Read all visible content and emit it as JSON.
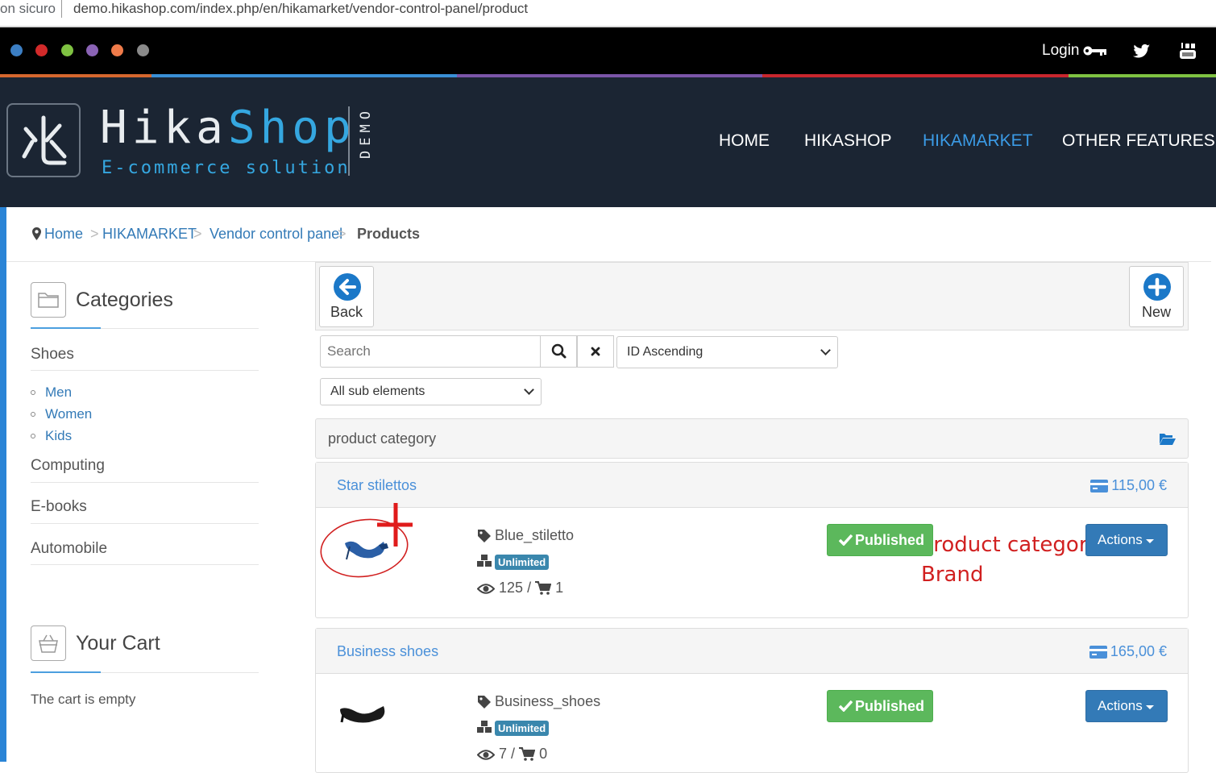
{
  "browser": {
    "insecure_label": "on sicuro",
    "url": "demo.hikashop.com/index.php/en/hikamarket/vendor-control-panel/product"
  },
  "topbar": {
    "dots": [
      "#3c7fc4",
      "#d22a2a",
      "#7fc242",
      "#8a63b5",
      "#ef7b4a",
      "#8a8a8a"
    ],
    "login_label": "Login",
    "icons": [
      "key-icon",
      "twitter-icon",
      "youtube-icon"
    ]
  },
  "colors": {
    "lines": [
      "#d5672e",
      "#3a8fd6",
      "#7b55a8",
      "#c8262d",
      "#7fc242"
    ],
    "accent": "#35a7e0",
    "header_bg": "#1b2533"
  },
  "logo": {
    "title_a": "Hika",
    "title_b": "Shop",
    "subtitle": "E-commerce solution",
    "demo": "DEMO"
  },
  "nav": {
    "items": [
      "HOME",
      "HIKASHOP",
      "HIKAMARKET",
      "OTHER FEATURES"
    ],
    "active": "HIKAMARKET"
  },
  "breadcrumb": {
    "home": "Home",
    "hikamarket": "HIKAMARKET",
    "vendor": "Vendor control panel",
    "current": "Products"
  },
  "sidebar": {
    "categories_title": "Categories",
    "categories": [
      "Shoes",
      "Computing",
      "E-books",
      "Automobile"
    ],
    "subcategories": [
      "Men",
      "Women",
      "Kids"
    ],
    "cart_title": "Your Cart",
    "cart_empty": "The cart is empty"
  },
  "toolbar": {
    "back_label": "Back",
    "new_label": "New"
  },
  "filters": {
    "search_placeholder": "Search",
    "sort": "ID Ascending",
    "sub_elements": "All sub elements"
  },
  "category_panel": {
    "label": "product category"
  },
  "products": [
    {
      "name": "Star stilettos",
      "price": "115,00 €",
      "code": "Blue_stiletto",
      "stock": "Unlimited",
      "views": "125",
      "sales": "1",
      "status": "Published",
      "actions": "Actions"
    },
    {
      "name": "Business shoes",
      "price": "165,00 €",
      "code": "Business_shoes",
      "stock": "Unlimited",
      "views": "7",
      "sales": "0",
      "status": "Published",
      "actions": "Actions"
    }
  ],
  "annotation": {
    "line1": "Product categories",
    "line2": "Brand"
  }
}
